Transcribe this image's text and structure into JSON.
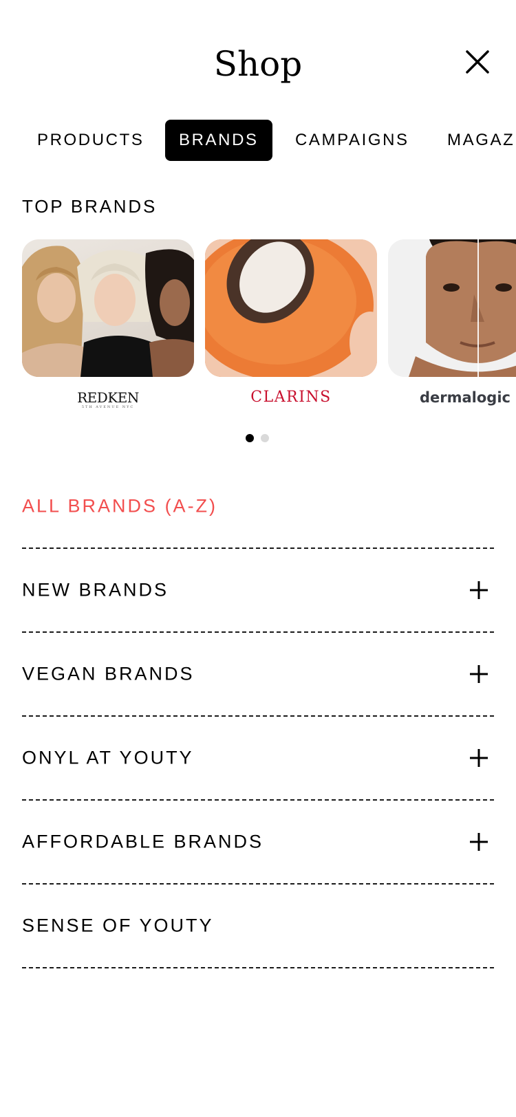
{
  "header": {
    "title": "Shop",
    "close_icon": "close-icon"
  },
  "tabs": [
    {
      "label": "PRODUCTS",
      "active": false
    },
    {
      "label": "BRANDS",
      "active": true
    },
    {
      "label": "CAMPAIGNS",
      "active": false
    },
    {
      "label": "MAGAZ",
      "active": false
    }
  ],
  "top_brands": {
    "title": "TOP BRANDS",
    "cards": [
      {
        "logo": "REDKEN",
        "logo_sub": "5TH AVENUE NYC",
        "image": "three women with different hair colors"
      },
      {
        "logo": "CLARINS",
        "image": "halved apricot with pit",
        "logo_color": "#c8102e"
      },
      {
        "logo": "dermalogic",
        "image": "man face split comparison"
      }
    ],
    "pagination": {
      "current": 1,
      "total": 2
    }
  },
  "menu": {
    "items": [
      {
        "label": "ALL BRANDS (A-Z)",
        "accent": true,
        "expandable": false
      },
      {
        "label": "NEW BRANDS",
        "expandable": true
      },
      {
        "label": "VEGAN BRANDS",
        "expandable": true
      },
      {
        "label": "ONYL AT YOUTY",
        "expandable": true
      },
      {
        "label": "AFFORDABLE BRANDS",
        "expandable": true
      },
      {
        "label": "SENSE OF YOUTY",
        "expandable": false
      }
    ]
  },
  "colors": {
    "accent": "#f24e4e",
    "active_tab_bg": "#000000",
    "active_tab_text": "#ffffff"
  }
}
